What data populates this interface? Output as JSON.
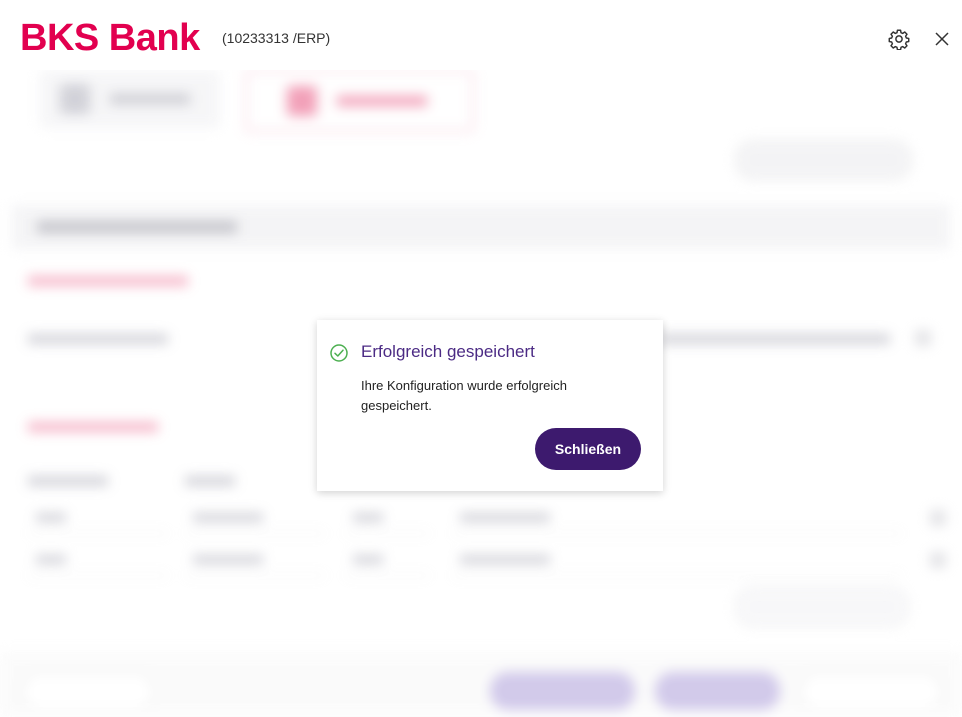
{
  "header": {
    "brand": "BKS Bank",
    "client_id": "(10233313 /ERP)",
    "settings_icon": "gear-icon",
    "close_icon": "close-icon"
  },
  "dialog": {
    "title": "Erfolgreich gespeichert",
    "message": "Ihre Konfiguration wurde erfolgreich gespeichert.",
    "close_label": "Schließen",
    "status_icon": "check-circle-icon"
  },
  "colors": {
    "brand": "#e2004f",
    "primary": "#3d1a6e",
    "title": "#4b2a84",
    "success": "#4caf50"
  }
}
